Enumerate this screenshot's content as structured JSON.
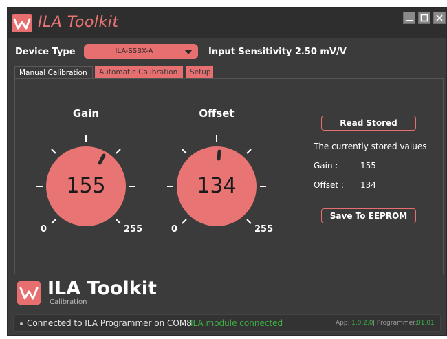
{
  "window": {
    "title": "ILA Toolkit",
    "controls": [
      "minimize-icon",
      "maximize-icon",
      "close-icon"
    ]
  },
  "device": {
    "label": "Device Type",
    "selected": "ILA-SSBX-A",
    "sensitivity": "Input Sensitivity 2.50 mV/V"
  },
  "tabs": [
    {
      "label": "Manual Calibration",
      "active": true
    },
    {
      "label": "Automatic Calibration",
      "active": false
    },
    {
      "label": "Setup",
      "active": false
    }
  ],
  "gain": {
    "title": "Gain",
    "value": "155",
    "min": "0",
    "max": "255"
  },
  "offset": {
    "title": "Offset",
    "value": "134",
    "min": "0",
    "max": "255"
  },
  "stored": {
    "read_button": "Read Stored",
    "caption": "The currently stored values",
    "gain_label": "Gain :",
    "gain_value": "155",
    "offset_label": "Offset :",
    "offset_value": "134",
    "save_button": "Save To EEPROM"
  },
  "footer": {
    "name": "ILA Toolkit",
    "subtitle": "Calibration"
  },
  "status": {
    "connection": "Connected to ILA Programmer on COM8",
    "module": "ILA module connected",
    "app_label": "App:",
    "app_version": "1.0.2.0",
    "separator": "| Programmer:",
    "programmer_version": "01.01"
  },
  "colors": {
    "accent": "#e76f6f",
    "ok_green": "#3cb043",
    "background": "#3b3b3b"
  }
}
